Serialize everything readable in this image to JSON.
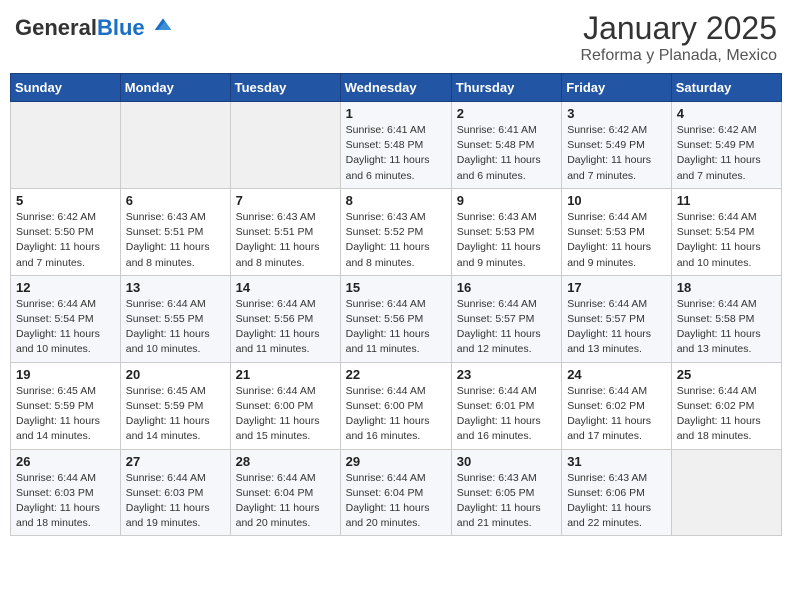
{
  "header": {
    "logo_general": "General",
    "logo_blue": "Blue",
    "month_title": "January 2025",
    "location": "Reforma y Planada, Mexico"
  },
  "days_of_week": [
    "Sunday",
    "Monday",
    "Tuesday",
    "Wednesday",
    "Thursday",
    "Friday",
    "Saturday"
  ],
  "weeks": [
    [
      {
        "day": "",
        "info": ""
      },
      {
        "day": "",
        "info": ""
      },
      {
        "day": "",
        "info": ""
      },
      {
        "day": "1",
        "info": "Sunrise: 6:41 AM\nSunset: 5:48 PM\nDaylight: 11 hours\nand 6 minutes."
      },
      {
        "day": "2",
        "info": "Sunrise: 6:41 AM\nSunset: 5:48 PM\nDaylight: 11 hours\nand 6 minutes."
      },
      {
        "day": "3",
        "info": "Sunrise: 6:42 AM\nSunset: 5:49 PM\nDaylight: 11 hours\nand 7 minutes."
      },
      {
        "day": "4",
        "info": "Sunrise: 6:42 AM\nSunset: 5:49 PM\nDaylight: 11 hours\nand 7 minutes."
      }
    ],
    [
      {
        "day": "5",
        "info": "Sunrise: 6:42 AM\nSunset: 5:50 PM\nDaylight: 11 hours\nand 7 minutes."
      },
      {
        "day": "6",
        "info": "Sunrise: 6:43 AM\nSunset: 5:51 PM\nDaylight: 11 hours\nand 8 minutes."
      },
      {
        "day": "7",
        "info": "Sunrise: 6:43 AM\nSunset: 5:51 PM\nDaylight: 11 hours\nand 8 minutes."
      },
      {
        "day": "8",
        "info": "Sunrise: 6:43 AM\nSunset: 5:52 PM\nDaylight: 11 hours\nand 8 minutes."
      },
      {
        "day": "9",
        "info": "Sunrise: 6:43 AM\nSunset: 5:53 PM\nDaylight: 11 hours\nand 9 minutes."
      },
      {
        "day": "10",
        "info": "Sunrise: 6:44 AM\nSunset: 5:53 PM\nDaylight: 11 hours\nand 9 minutes."
      },
      {
        "day": "11",
        "info": "Sunrise: 6:44 AM\nSunset: 5:54 PM\nDaylight: 11 hours\nand 10 minutes."
      }
    ],
    [
      {
        "day": "12",
        "info": "Sunrise: 6:44 AM\nSunset: 5:54 PM\nDaylight: 11 hours\nand 10 minutes."
      },
      {
        "day": "13",
        "info": "Sunrise: 6:44 AM\nSunset: 5:55 PM\nDaylight: 11 hours\nand 10 minutes."
      },
      {
        "day": "14",
        "info": "Sunrise: 6:44 AM\nSunset: 5:56 PM\nDaylight: 11 hours\nand 11 minutes."
      },
      {
        "day": "15",
        "info": "Sunrise: 6:44 AM\nSunset: 5:56 PM\nDaylight: 11 hours\nand 11 minutes."
      },
      {
        "day": "16",
        "info": "Sunrise: 6:44 AM\nSunset: 5:57 PM\nDaylight: 11 hours\nand 12 minutes."
      },
      {
        "day": "17",
        "info": "Sunrise: 6:44 AM\nSunset: 5:57 PM\nDaylight: 11 hours\nand 13 minutes."
      },
      {
        "day": "18",
        "info": "Sunrise: 6:44 AM\nSunset: 5:58 PM\nDaylight: 11 hours\nand 13 minutes."
      }
    ],
    [
      {
        "day": "19",
        "info": "Sunrise: 6:45 AM\nSunset: 5:59 PM\nDaylight: 11 hours\nand 14 minutes."
      },
      {
        "day": "20",
        "info": "Sunrise: 6:45 AM\nSunset: 5:59 PM\nDaylight: 11 hours\nand 14 minutes."
      },
      {
        "day": "21",
        "info": "Sunrise: 6:44 AM\nSunset: 6:00 PM\nDaylight: 11 hours\nand 15 minutes."
      },
      {
        "day": "22",
        "info": "Sunrise: 6:44 AM\nSunset: 6:00 PM\nDaylight: 11 hours\nand 16 minutes."
      },
      {
        "day": "23",
        "info": "Sunrise: 6:44 AM\nSunset: 6:01 PM\nDaylight: 11 hours\nand 16 minutes."
      },
      {
        "day": "24",
        "info": "Sunrise: 6:44 AM\nSunset: 6:02 PM\nDaylight: 11 hours\nand 17 minutes."
      },
      {
        "day": "25",
        "info": "Sunrise: 6:44 AM\nSunset: 6:02 PM\nDaylight: 11 hours\nand 18 minutes."
      }
    ],
    [
      {
        "day": "26",
        "info": "Sunrise: 6:44 AM\nSunset: 6:03 PM\nDaylight: 11 hours\nand 18 minutes."
      },
      {
        "day": "27",
        "info": "Sunrise: 6:44 AM\nSunset: 6:03 PM\nDaylight: 11 hours\nand 19 minutes."
      },
      {
        "day": "28",
        "info": "Sunrise: 6:44 AM\nSunset: 6:04 PM\nDaylight: 11 hours\nand 20 minutes."
      },
      {
        "day": "29",
        "info": "Sunrise: 6:44 AM\nSunset: 6:04 PM\nDaylight: 11 hours\nand 20 minutes."
      },
      {
        "day": "30",
        "info": "Sunrise: 6:43 AM\nSunset: 6:05 PM\nDaylight: 11 hours\nand 21 minutes."
      },
      {
        "day": "31",
        "info": "Sunrise: 6:43 AM\nSunset: 6:06 PM\nDaylight: 11 hours\nand 22 minutes."
      },
      {
        "day": "",
        "info": ""
      }
    ]
  ]
}
